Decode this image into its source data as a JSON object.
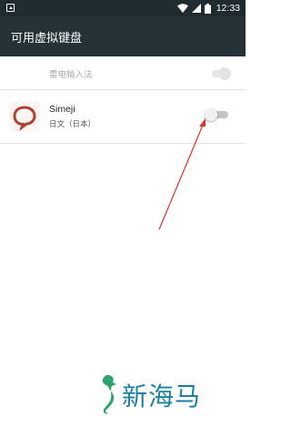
{
  "status_bar": {
    "time": "12:33",
    "icons": [
      "notification-icon",
      "wifi-icon",
      "signal-icon",
      "battery-icon"
    ]
  },
  "app_bar": {
    "title": "可用虚拟键盘",
    "background": "#263238"
  },
  "keyboards": [
    {
      "name": "雷电输入法",
      "enabled": true,
      "disabled_row": true
    },
    {
      "name": "Simeji",
      "subtitle": "日文（日本）",
      "enabled": false,
      "icon": "simeji-icon"
    }
  ],
  "annotation": {
    "type": "red-arrow",
    "color": "#d9342b"
  },
  "watermark": {
    "text": "新海马",
    "color": "#1a7fa3"
  }
}
